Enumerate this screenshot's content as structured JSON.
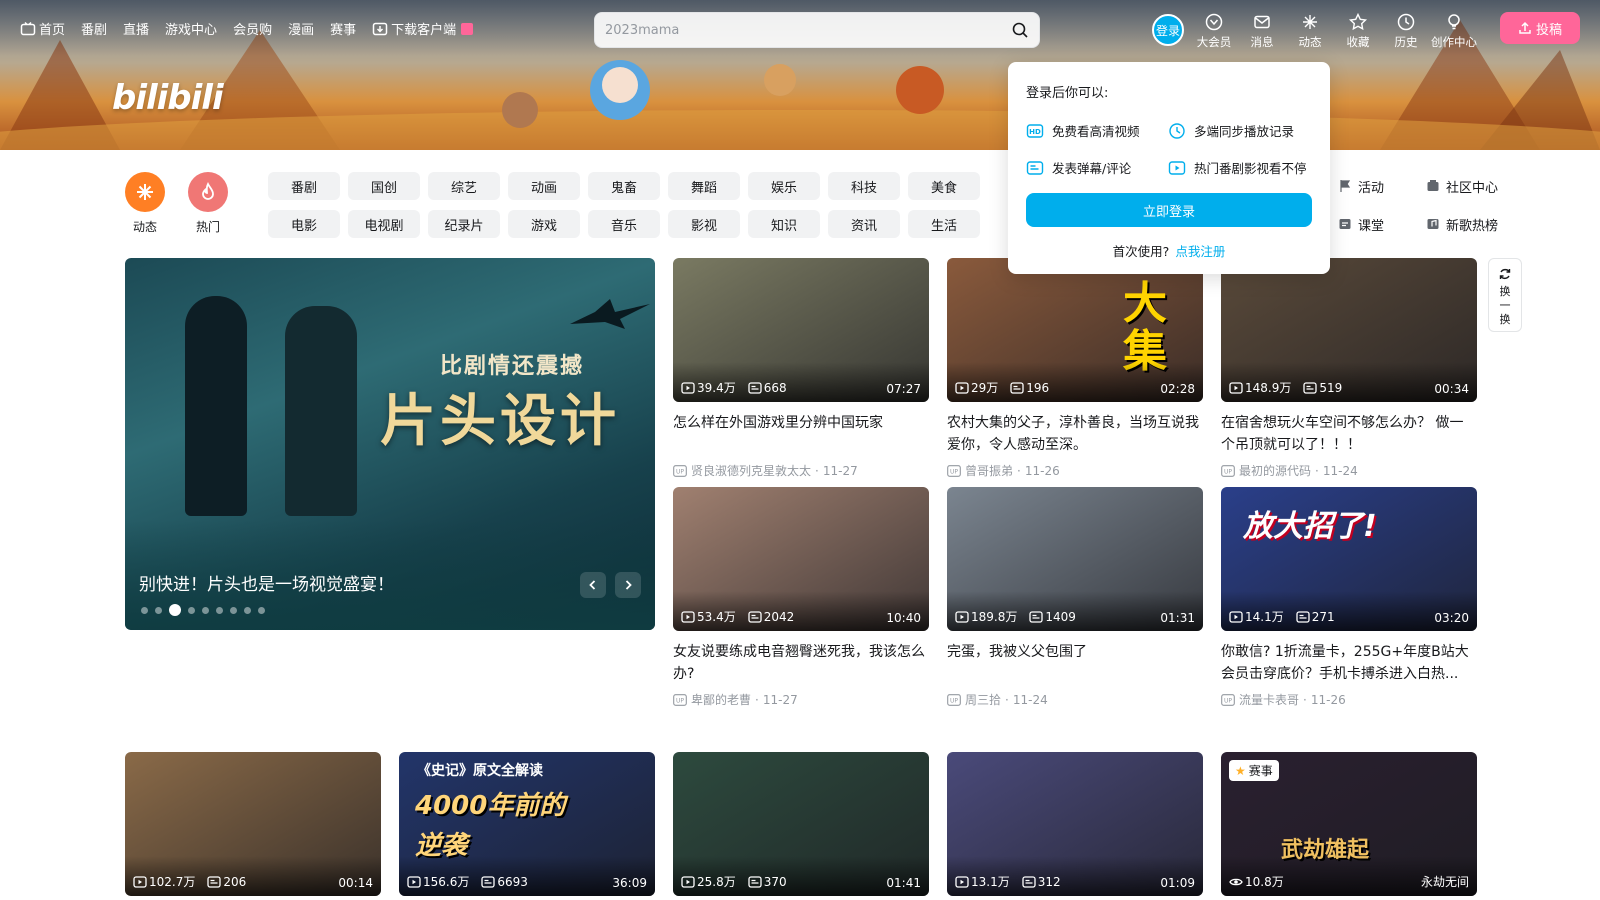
{
  "nav": {
    "left_items": [
      {
        "label": "首页",
        "icon": "tv-icon"
      },
      {
        "label": "番剧"
      },
      {
        "label": "直播"
      },
      {
        "label": "游戏中心"
      },
      {
        "label": "会员购"
      },
      {
        "label": "漫画"
      },
      {
        "label": "赛事"
      },
      {
        "label": "下载客户端",
        "icon": "download-icon"
      }
    ],
    "search_placeholder": "2023mama",
    "login_label": "登录",
    "right_items": [
      {
        "label": "大会员",
        "icon": "vip-icon"
      },
      {
        "label": "消息",
        "icon": "message-icon"
      },
      {
        "label": "动态",
        "icon": "dynamic-icon"
      },
      {
        "label": "收藏",
        "icon": "star-icon"
      },
      {
        "label": "历史",
        "icon": "clock-icon"
      },
      {
        "label": "创作中心",
        "icon": "bulb-icon"
      }
    ],
    "upload_label": "投稿",
    "logo_text": "bilibili"
  },
  "channels": {
    "circles": [
      {
        "label": "动态",
        "color": "#ff7f24"
      },
      {
        "label": "热门",
        "color": "#f07775"
      }
    ],
    "chips": [
      "番剧",
      "国创",
      "综艺",
      "动画",
      "鬼畜",
      "舞蹈",
      "娱乐",
      "科技",
      "美食",
      "电影",
      "电视剧",
      "纪录片",
      "游戏",
      "音乐",
      "影视",
      "知识",
      "资讯",
      "生活"
    ],
    "side_links": [
      {
        "label": "活动",
        "icon": "flag-icon"
      },
      {
        "label": "社区中心",
        "icon": "community-icon"
      },
      {
        "label": "课堂",
        "icon": "classroom-icon"
      },
      {
        "label": "新歌热榜",
        "icon": "music-chart-icon"
      }
    ]
  },
  "hero": {
    "subtitle": "比剧情还震撼",
    "headline": "片头设计",
    "caption": "别快进！片头也是一场视觉盛宴！",
    "active_dot": 3,
    "dot_count": 9
  },
  "refresh_label": [
    "换",
    "一",
    "换"
  ],
  "videos": [
    {
      "views": "39.4万",
      "danmaku": "668",
      "duration": "07:27",
      "title": "怎么样在外国游戏里分辨中国玩家",
      "author": "贤良淑德列克星敦太太",
      "date": "11-27",
      "thumb_color": "#7a7a62"
    },
    {
      "views": "29万",
      "danmaku": "196",
      "duration": "02:28",
      "title": "农村大集的父子，淳朴善良，当场互说我爱你，令人感动至深。",
      "author": "曾哥振弟",
      "date": "11-26",
      "thumb_color": "#8a5a3c",
      "overlay": "大集"
    },
    {
      "views": "148.9万",
      "danmaku": "519",
      "duration": "00:34",
      "title": "在宿舍想玩火车空间不够怎么办？ 做一个吊顶就可以了！！！",
      "author": "最初的源代码",
      "date": "11-24",
      "thumb_color": "#5a4a3a"
    },
    {
      "views": "53.4万",
      "danmaku": "2042",
      "duration": "10:40",
      "title": "女友说要练成电音翘臀迷死我，我该怎么办?",
      "author": "卑鄙的老曹",
      "date": "11-27",
      "thumb_color": "#a08070"
    },
    {
      "views": "189.8万",
      "danmaku": "1409",
      "duration": "01:31",
      "title": "完蛋，我被义父包围了",
      "author": "周三拾",
      "date": "11-24",
      "thumb_color": "#7b8590"
    },
    {
      "views": "14.1万",
      "danmaku": "271",
      "duration": "03:20",
      "title": "你敢信? 1折流量卡，255G+年度B站大会员击穿底价？手机卡搏杀进入白热...",
      "author": "流量卡表哥",
      "date": "11-26",
      "thumb_color": "#2a3f8a",
      "overlay": "放大招了!"
    },
    {
      "views": "102.7万",
      "danmaku": "206",
      "duration": "00:14",
      "thumb_color": "#8a6a48"
    },
    {
      "views": "156.6万",
      "danmaku": "6693",
      "duration": "36:09",
      "thumb_color": "#22356a",
      "overlay_small": "《史记》原文全解读",
      "overlay": "4000年前的逆袭"
    },
    {
      "views": "25.8万",
      "danmaku": "370",
      "duration": "01:41",
      "thumb_color": "#2d4a3e"
    },
    {
      "views": "13.1万",
      "danmaku": "312",
      "duration": "01:09",
      "thumb_color": "#4a4a7a"
    },
    {
      "views": "10.8万",
      "duration": "永劫无间",
      "badge": "赛事",
      "thumb_color": "#2a2030",
      "overlay": "武劫雄起"
    }
  ],
  "popup": {
    "heading": "登录后你可以:",
    "benefits": [
      {
        "label": "免费看高清视频",
        "icon": "hd-icon"
      },
      {
        "label": "多端同步播放记录",
        "icon": "sync-clock-icon"
      },
      {
        "label": "发表弹幕/评论",
        "icon": "danmaku-icon"
      },
      {
        "label": "热门番剧影视看不停",
        "icon": "play-box-icon"
      }
    ],
    "login_button": "立即登录",
    "register_prefix": "首次使用?",
    "register_link": "点我注册"
  }
}
